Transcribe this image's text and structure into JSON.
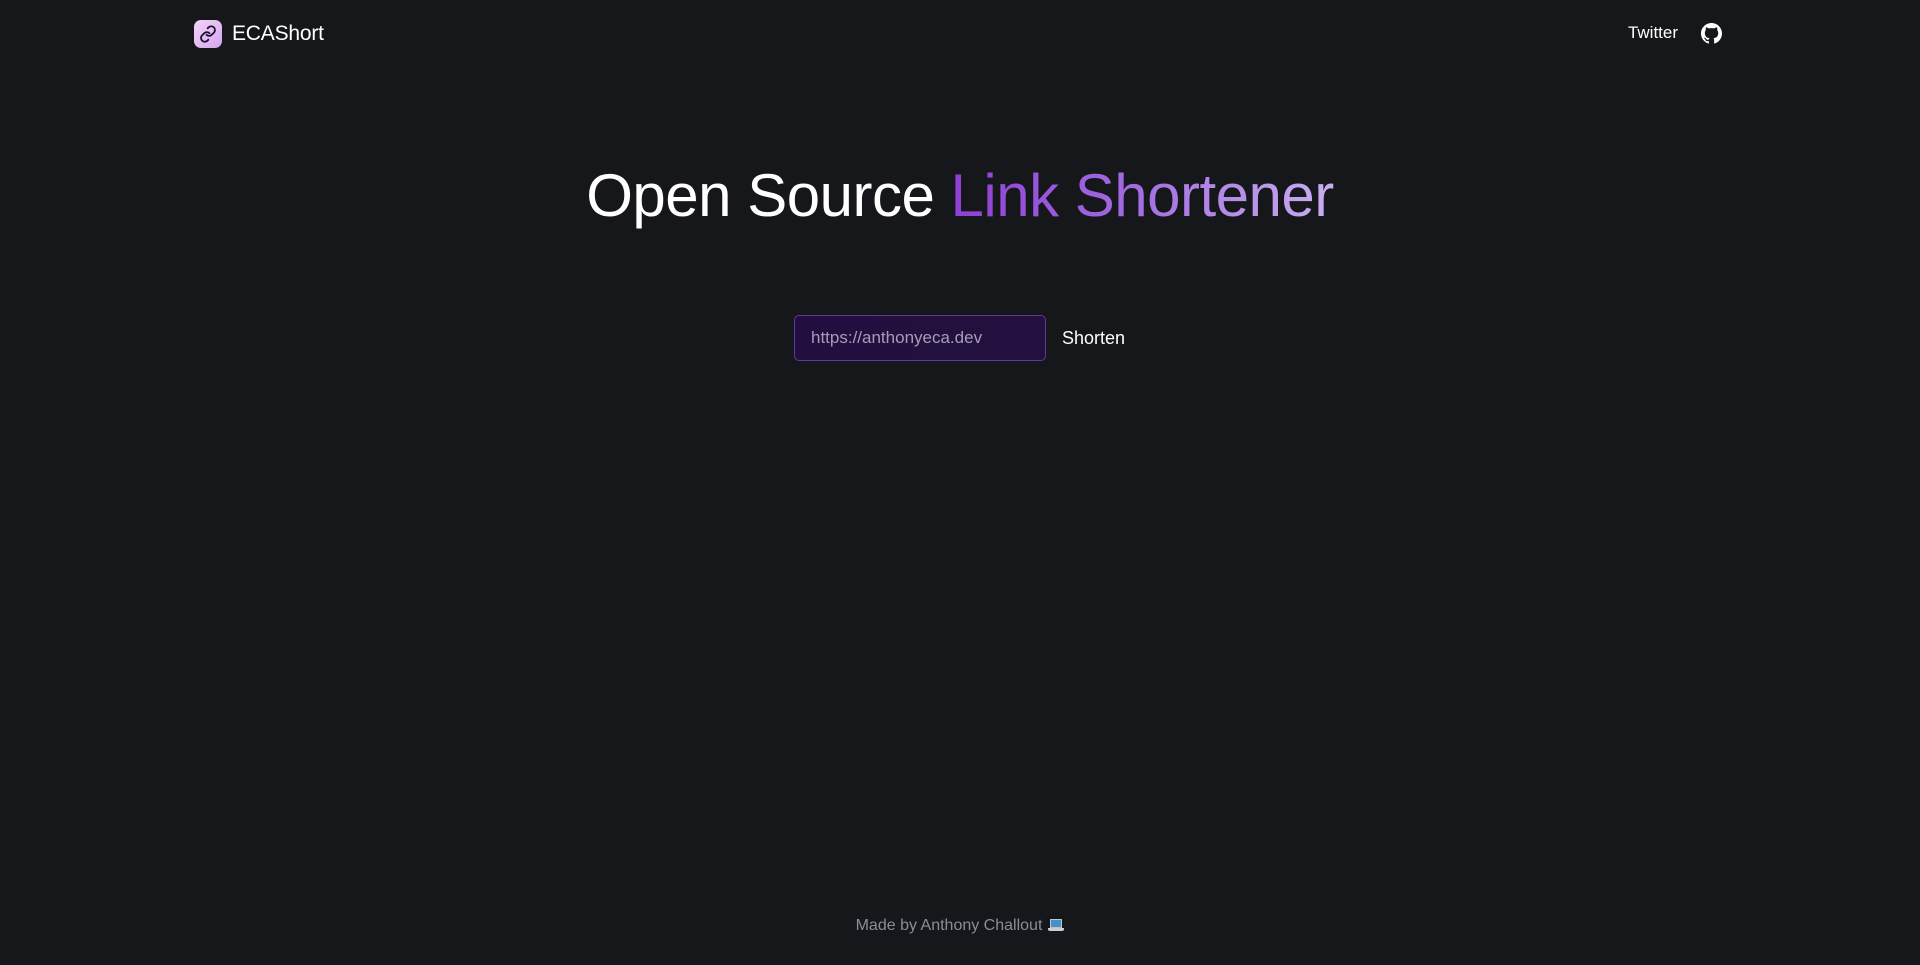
{
  "header": {
    "brand_name": "ECAShort",
    "logo_icon": "link-icon",
    "nav": {
      "twitter_label": "Twitter",
      "github_icon": "github-icon"
    }
  },
  "hero": {
    "title_plain": "Open Source ",
    "title_accent": "Link Shortener",
    "accent_gradient": [
      "#8f3fd6",
      "#a169e0",
      "#c8b0ef"
    ]
  },
  "form": {
    "url_value": "",
    "url_placeholder": "https://anthonyeca.dev",
    "submit_label": "Shorten"
  },
  "footer": {
    "text": "Made by Anthony Challout",
    "emoji_icon": "laptop-icon"
  },
  "colors": {
    "background": "#16171b",
    "input_border": "#5c3b96",
    "input_background": "#230f3f",
    "footer_text": "#8b8d95"
  }
}
